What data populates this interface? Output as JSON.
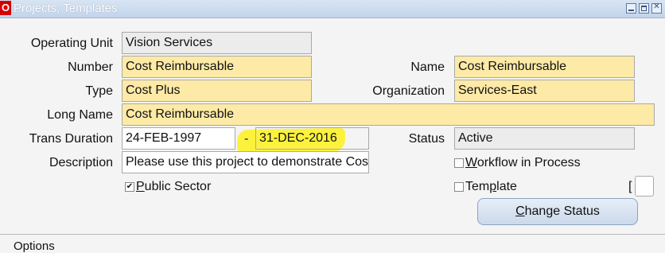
{
  "window": {
    "title": "Projects, Templates",
    "logo_letter": "O"
  },
  "form": {
    "operating_unit": {
      "label": "Operating Unit",
      "value": "Vision Services"
    },
    "number": {
      "label": "Number",
      "value": "Cost Reimbursable"
    },
    "name": {
      "label": "Name",
      "value": "Cost Reimbursable"
    },
    "type": {
      "label": "Type",
      "value": "Cost Plus"
    },
    "organization": {
      "label": "Organization",
      "value": "Services-East"
    },
    "long_name": {
      "label": "Long Name",
      "value": "Cost Reimbursable"
    },
    "trans_duration": {
      "label": "Trans Duration",
      "from": "24-FEB-1997",
      "separator": "-",
      "to": "31-DEC-2016"
    },
    "status": {
      "label": "Status",
      "value": "Active"
    },
    "description": {
      "label": "Description",
      "value": "Please use this project to demonstrate Cos"
    },
    "workflow": {
      "label_pre": "",
      "label_u": "W",
      "label_post": "orkflow in Process",
      "checked": false
    },
    "public_sector": {
      "label_u": "P",
      "label_post": "ublic Sector",
      "checked": true
    },
    "template": {
      "label_pre": "Tem",
      "label_u": "p",
      "label_post": "late",
      "checked": false
    },
    "bracket": "[",
    "change_status_button": {
      "label_u": "C",
      "label_post": "hange Status"
    }
  },
  "sections": {
    "options_label": "Options"
  },
  "colors": {
    "required": "#fdeaa6",
    "readonly": "#ececec",
    "highlight": "#fff200"
  }
}
